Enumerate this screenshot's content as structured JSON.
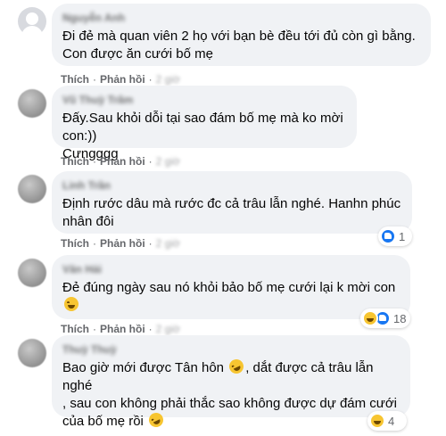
{
  "labels": {
    "like": "Thích",
    "reply": "Phản hồi",
    "separator": "·"
  },
  "comments": [
    {
      "author": "Nguyễn Anh",
      "text": "Đi đẻ mà quan viên 2 họ với bạn bè đều tới đủ còn gì bằng. Con được ăn cưới bố mẹ",
      "time": "2 giờ",
      "reaction_count": ""
    },
    {
      "author": "Vũ Thuỳ Trâm",
      "text": "Đấy.Sau khỏi dỗi tại sao đám bố mẹ mà ko mời con:))\nCưngggg",
      "time": "2 giờ",
      "reaction_count": ""
    },
    {
      "author": "Linh Trần",
      "text": "Định rước dâu mà rước đc cả trâu lẫn nghé. Hanhn phúc nhân đôi",
      "time": "2 giờ",
      "reaction_count": "1",
      "reaction_types": [
        "like"
      ]
    },
    {
      "author": "Văn Hải",
      "text": "Đẻ đúng ngày sau nó khỏi bảo bố mẹ cưới lại k mời con",
      "time": "2 giờ",
      "reaction_count": "18",
      "reaction_types": [
        "haha",
        "like"
      ]
    },
    {
      "author": "Thuỳ Thuỳ",
      "text_parts": [
        "Bao giờ mới được Tân hôn",
        ", dắt được cả trâu lẫn nghé\n, sau con không phải thắc sao không được dự đám cưới\ncủa bố mẹ rồi"
      ],
      "time": "2 giờ",
      "reaction_count": "4",
      "reaction_types": [
        "haha"
      ]
    }
  ],
  "emoji_names": [
    "rolling-laughing-emoji",
    "laughing-emoji"
  ]
}
